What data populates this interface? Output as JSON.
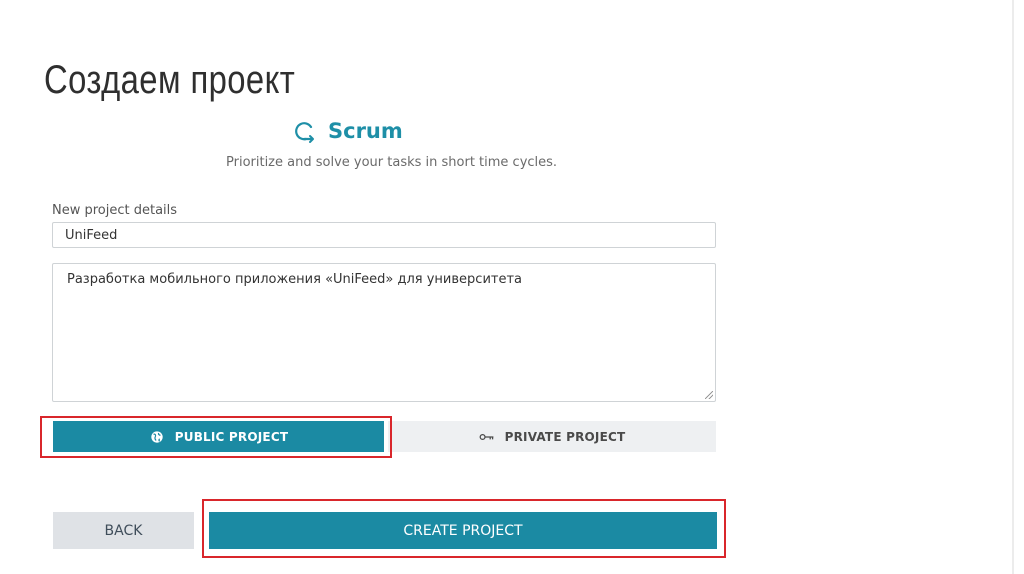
{
  "slide": {
    "title": "Создаем проект"
  },
  "header": {
    "icon": "cycle-arrow-icon",
    "title": "Scrum",
    "subtitle": "Prioritize and solve your tasks in short time cycles."
  },
  "form": {
    "details_label": "New project details",
    "name_value": "UniFeed",
    "description_value": "Разработка мобильного приложения «UniFeed» для университета"
  },
  "visibility": {
    "public_label": "PUBLIC PROJECT",
    "public_icon": "globe-icon",
    "private_label": "PRIVATE PROJECT",
    "private_icon": "key-icon",
    "selected": "public"
  },
  "actions": {
    "back_label": "BACK",
    "create_label": "CREATE PROJECT"
  },
  "colors": {
    "accent": "#1b8aa3",
    "highlight": "#d9262b",
    "secondary_button": "#dfe2e6"
  }
}
